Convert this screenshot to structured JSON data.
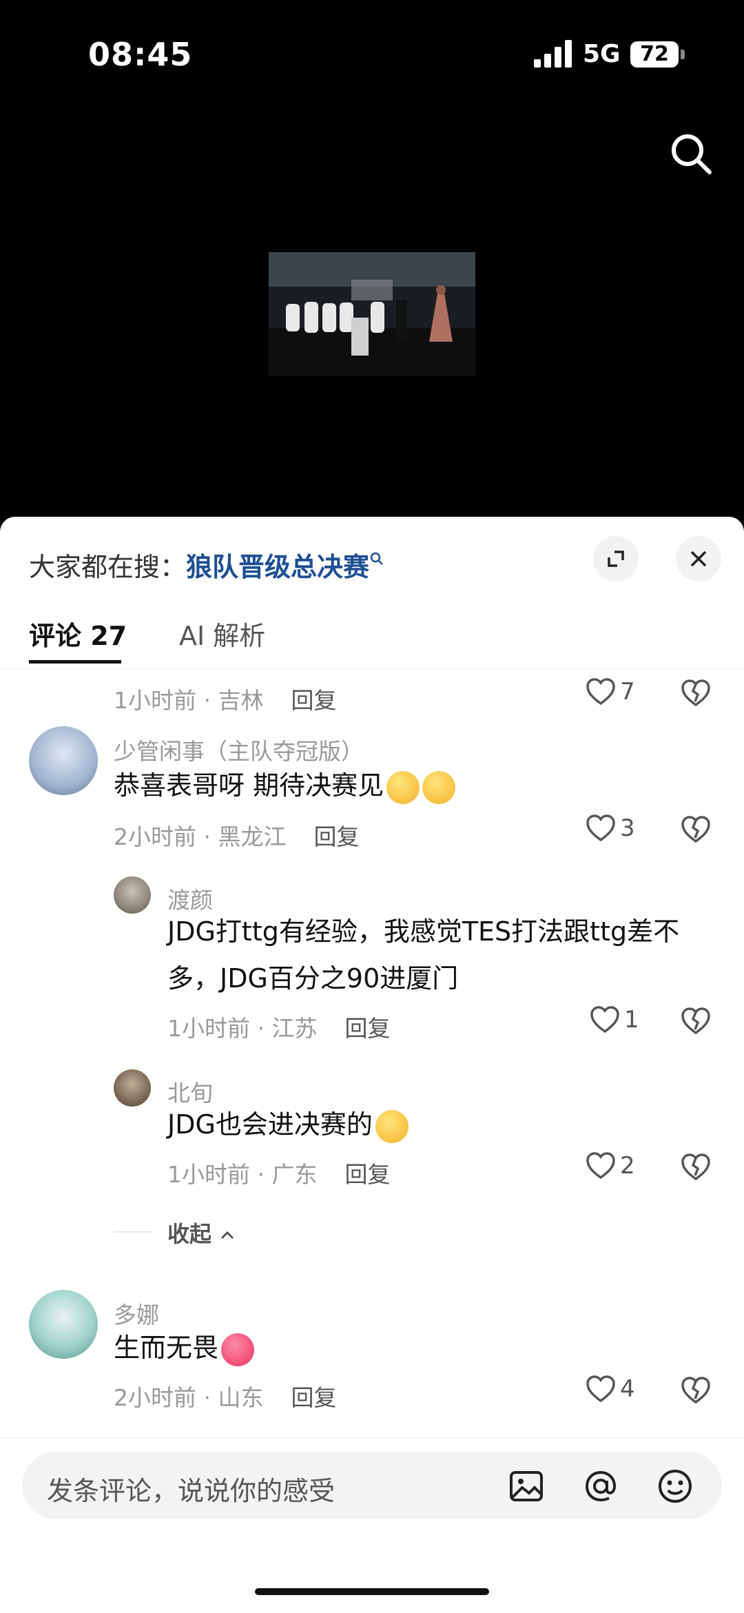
{
  "status_bar": {
    "time": "08:45",
    "network": "5G",
    "battery": "72"
  },
  "sheet": {
    "hot_search_label": "大家都在搜：",
    "hot_search_term": "狼队晋级总决赛",
    "tabs": [
      {
        "label": "评论 27"
      },
      {
        "label": "AI 解析"
      }
    ]
  },
  "comments": {
    "first": {
      "time": "1小时前 · 吉林",
      "reply": "回复",
      "likes": "7"
    },
    "second": {
      "username": "少管闲事（主队夺冠版）",
      "text": "恭喜表哥呀 期待决赛见",
      "time": "2小时前 · 黑龙江",
      "reply": "回复",
      "likes": "3",
      "replies": [
        {
          "username": "渡颜",
          "text": "JDG打ttg有经验，我感觉TES打法跟ttg差不多，JDG百分之90进厦门",
          "time": "1小时前 · 江苏",
          "reply": "回复",
          "likes": "1"
        },
        {
          "username": "北旬",
          "text": "JDG也会进决赛的",
          "time": "1小时前 · 广东",
          "reply": "回复",
          "likes": "2"
        }
      ],
      "collapse_label": "收起"
    },
    "third": {
      "username": "多娜",
      "text": "生而无畏",
      "time": "2小时前 · 山东",
      "reply": "回复",
      "likes": "4"
    }
  },
  "input": {
    "placeholder": "发条评论，说说你的感受"
  },
  "icons": [
    "search-icon",
    "expand-icon",
    "close-icon",
    "heart-icon",
    "broken-heart-icon",
    "image-icon",
    "at-icon",
    "emoji-icon"
  ]
}
